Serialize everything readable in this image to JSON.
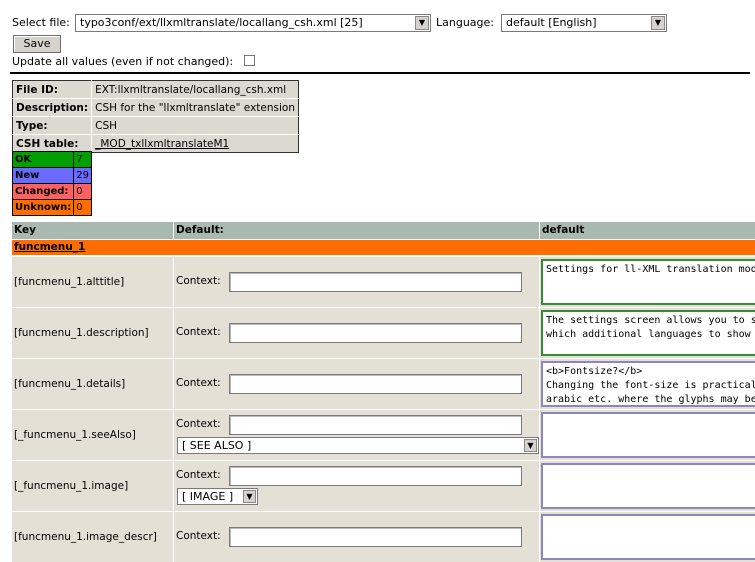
{
  "toolbar": {
    "select_file_label": "Select file:",
    "file_value": "typo3conf/ext/llxmltranslate/locallang_csh.xml [25]",
    "language_label": "Language:",
    "language_value": "default [English]",
    "save_label": "Save",
    "update_all_label": "Update all values (even if not changed):"
  },
  "file_info": {
    "rows": [
      {
        "key": "File ID:",
        "value": "EXT:llxmltranslate/locallang_csh.xml"
      },
      {
        "key": "Description:",
        "value": "CSH for the \"llxmltranslate\" extension"
      },
      {
        "key": "Type:",
        "value": "CSH"
      },
      {
        "key": "CSH table:",
        "value": "_MOD_txllxmltranslateM1"
      }
    ]
  },
  "stats": [
    {
      "label": "OK",
      "count": "7",
      "color": "#00a000"
    },
    {
      "label": "New",
      "count": "29",
      "color": "#6a6aff"
    },
    {
      "label": "Changed:",
      "count": "0",
      "color": "#ff6060"
    },
    {
      "label": "Unknown:",
      "count": "0",
      "color": "#ff6c00"
    }
  ],
  "grid": {
    "col_key": "Key",
    "col_default": "Default:",
    "col_lang": "default",
    "section": "funcmenu_1",
    "context_label": "Context:",
    "rows": [
      {
        "key": "[funcmenu_1.alttitle]",
        "text": "Settings for ll-XML translation module",
        "border": "green"
      },
      {
        "key": "[funcmenu_1.description]",
        "text": "The settings screen allows you to sele\nwhich additional languages to show wh",
        "border": "green"
      },
      {
        "key": "[funcmenu_1.details]",
        "text": "<b>Fontsize?</b>\nChanging the font-size is practical for\narabic etc. where the glyphs may be re",
        "border": "purple"
      },
      {
        "key": "[_funcmenu_1.seeAlso]",
        "text": "",
        "border": "purple",
        "select": "[ SEE ALSO ]"
      },
      {
        "key": "[_funcmenu_1.image]",
        "text": "",
        "border": "purple",
        "select": "[ IMAGE ]"
      },
      {
        "key": "[funcmenu_1.image_descr]",
        "text": "",
        "border": "purple"
      }
    ]
  }
}
